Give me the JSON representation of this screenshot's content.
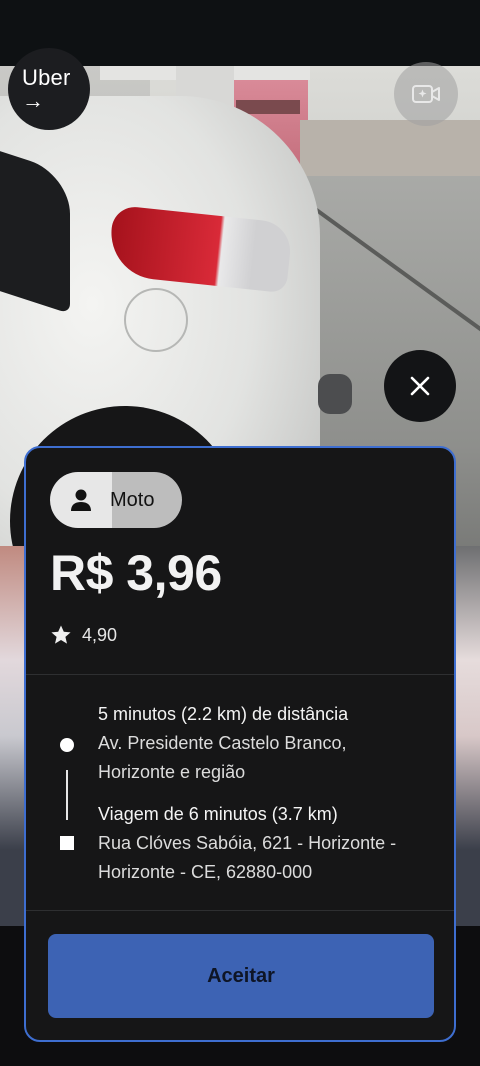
{
  "brand": {
    "logo_text": "Uber",
    "logo_arrow": "→"
  },
  "icons": {
    "camera": "video-camera-sparkle-icon",
    "close": "close-icon",
    "rider": "person-icon",
    "star": "star-icon"
  },
  "offer": {
    "product": "Moto",
    "price": "R$ 3,96",
    "rating": "4,90",
    "pickup": {
      "eta": "5 minutos (2.2 km) de distância",
      "address_line1": "Av. Presidente Castelo Branco,",
      "address_line2": "Horizonte e região"
    },
    "dropoff": {
      "trip": "Viagem de 6 minutos (3.7 km)",
      "address_line1": "Rua Clóves Sabóia, 621 - Horizonte -",
      "address_line2": "Horizonte - CE, 62880-000"
    },
    "accept_label": "Aceitar"
  },
  "colors": {
    "card_border": "#3e6ed0",
    "accept_button": "#3d63b4",
    "card_background": "#161617"
  }
}
